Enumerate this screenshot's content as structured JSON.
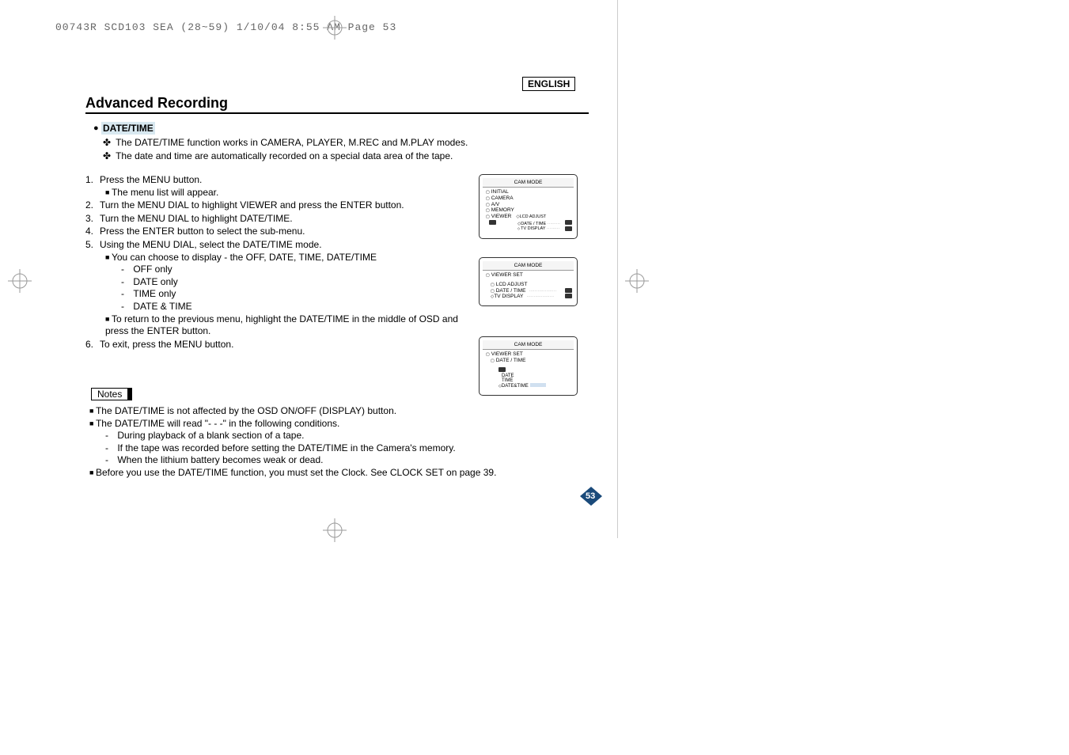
{
  "header_meta": "00743R SCD103 SEA (28~59)  1/10/04 8:55 AM  Page 53",
  "language": "ENGLISH",
  "page_title": "Advanced Recording",
  "section_heading": "DATE/TIME",
  "intro": [
    "The DATE/TIME function works in CAMERA, PLAYER, M.REC and M.PLAY modes.",
    "The date and time are automatically recorded on a special data area of the tape."
  ],
  "steps": [
    {
      "num": "1.",
      "text": "Press the MENU button.",
      "subs": [
        {
          "type": "square",
          "text": "The menu list will appear."
        }
      ]
    },
    {
      "num": "2.",
      "text": "Turn the MENU DIAL to highlight VIEWER and  press the ENTER button."
    },
    {
      "num": "3.",
      "text": "Turn the MENU DIAL to highlight DATE/TIME."
    },
    {
      "num": "4.",
      "text": "Press the ENTER button to select the sub-menu."
    },
    {
      "num": "5.",
      "text": "Using the MENU DIAL, select the DATE/TIME mode.",
      "subs": [
        {
          "type": "square",
          "text": "You can choose to display - the OFF, DATE, TIME, DATE/TIME",
          "dashes": [
            "OFF only",
            "DATE only",
            "TIME only",
            "DATE & TIME"
          ]
        },
        {
          "type": "square",
          "text": "To return to the previous menu, highlight the DATE/TIME in the middle of OSD and press the ENTER button."
        }
      ]
    },
    {
      "num": "6.",
      "text": "To exit, press the MENU button."
    }
  ],
  "notes_label": "Notes",
  "notes": [
    {
      "type": "square",
      "text": "The DATE/TIME is not affected by the OSD ON/OFF (DISPLAY) button."
    },
    {
      "type": "square",
      "text": "The DATE/TIME will read \"- - -\" in the following conditions.",
      "dashes": [
        "During playback of a blank section of a tape.",
        "If the tape was recorded before setting the DATE/TIME in the Camera's memory.",
        "When the lithium battery becomes weak or dead."
      ]
    },
    {
      "type": "square",
      "text": "Before you use the DATE/TIME function, you must set the Clock. See CLOCK SET on page 39."
    }
  ],
  "page_number": "53",
  "diagram1": {
    "title": "CAM  MODE",
    "items": [
      "INITIAL",
      "CAMERA",
      "A/V",
      "MEMORY",
      "VIEWER"
    ],
    "subs": [
      "LCD ADJUST",
      "DATE / TIME",
      "TV DISPLAY"
    ]
  },
  "diagram2": {
    "title": "CAM  MODE",
    "header": "VIEWER SET",
    "items": [
      "LCD ADJUST",
      "DATE / TIME",
      "TV DISPLAY"
    ]
  },
  "diagram3": {
    "title": "CAM  MODE",
    "header": "VIEWER SET",
    "sub": "DATE / TIME",
    "items": [
      "DATE",
      "TIME",
      "DATE&TIME"
    ]
  }
}
